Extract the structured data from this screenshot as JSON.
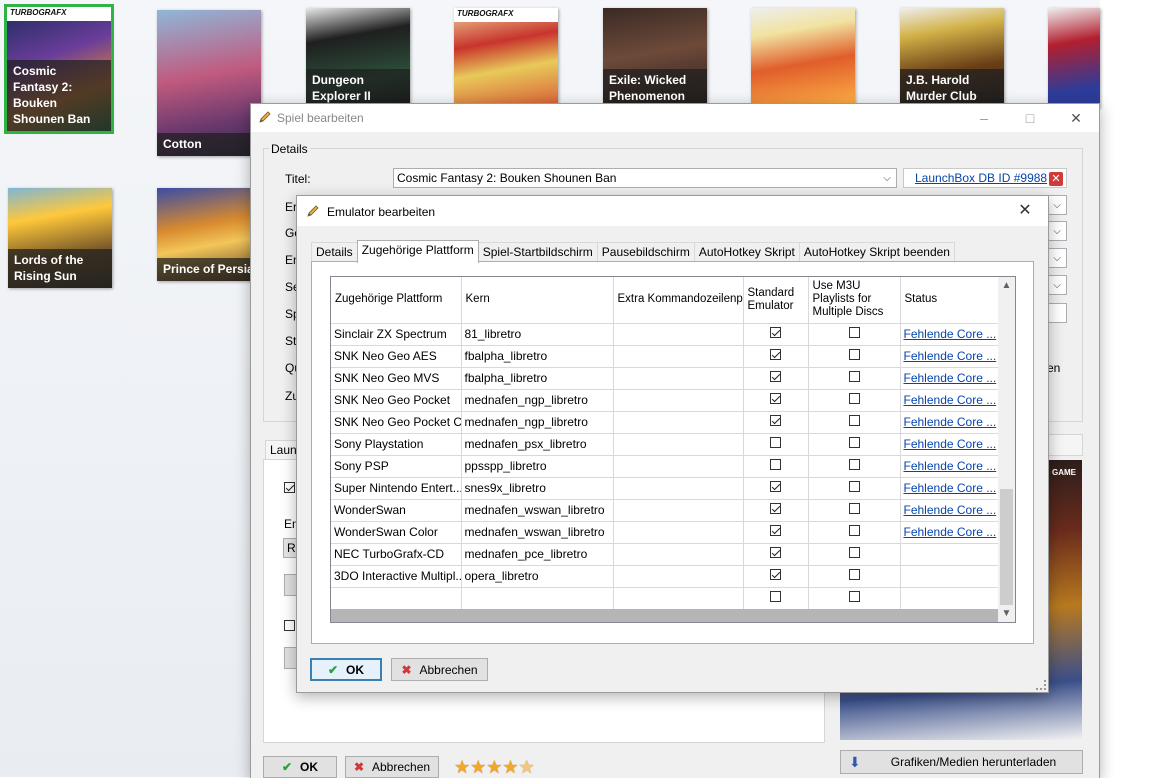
{
  "background": {
    "tiles": [
      {
        "label": "Cosmic Fantasy 2: Bouken Shounen Ban",
        "badge": "TURBOGRAFX"
      },
      {
        "label": "Cotton"
      },
      {
        "label": "Dungeon Explorer II"
      },
      {
        "label": "",
        "badge": "TURBOGRAFX"
      },
      {
        "label": "Exile: Wicked Phenomenon"
      },
      {
        "label": ""
      },
      {
        "label": "J.B. Harold Murder Club"
      },
      {
        "label": ""
      },
      {
        "label": "Lords of the Rising Sun"
      },
      {
        "label": "Prince of Persia"
      }
    ]
  },
  "edit_dialog": {
    "title": "Spiel bearbeiten",
    "details_group": "Details",
    "title_label": "Titel:",
    "title_value": "Cosmic Fantasy 2: Bouken Shounen Ban",
    "db_link": "LaunchBox DB ID #9988",
    "side_labels": [
      "Ers",
      "Ge",
      "En",
      "Se",
      "Sp",
      "Sta",
      "Qu",
      "Zu"
    ],
    "launch_tab_fragment": "Launc",
    "em_fragment": "Em",
    "re_fragment": "Re",
    "right_fragment": "en",
    "cover_badge": "GAME",
    "ok": "OK",
    "cancel": "Abbrechen",
    "rating": 4.5,
    "download_button": "Grafiken/Medien herunterladen"
  },
  "emulator_dialog": {
    "title": "Emulator bearbeiten",
    "tabs": [
      "Details",
      "Zugehörige Plattform",
      "Spiel-Startbildschirm",
      "Pausebildschirm",
      "AutoHotkey Skript",
      "AutoHotkey Skript beenden"
    ],
    "columns": [
      "Zugehörige Plattform",
      "Kern",
      "Extra Kommandozeilenparameter",
      "Standard Emulator",
      "Use M3U Playlists for Multiple Discs",
      "Status"
    ],
    "rows": [
      {
        "platform": "Sinclair ZX Spectrum",
        "core": "81_libretro",
        "extra": "",
        "standard": true,
        "m3u": false,
        "status": "Fehlende Core ..."
      },
      {
        "platform": "SNK Neo Geo AES",
        "core": "fbalpha_libretro",
        "extra": "",
        "standard": true,
        "m3u": false,
        "status": "Fehlende Core ..."
      },
      {
        "platform": "SNK Neo Geo MVS",
        "core": "fbalpha_libretro",
        "extra": "",
        "standard": true,
        "m3u": false,
        "status": "Fehlende Core ..."
      },
      {
        "platform": "SNK Neo Geo Pocket",
        "core": "mednafen_ngp_libretro",
        "extra": "",
        "standard": true,
        "m3u": false,
        "status": "Fehlende Core ..."
      },
      {
        "platform": "SNK Neo Geo Pocket C...",
        "core": "mednafen_ngp_libretro",
        "extra": "",
        "standard": true,
        "m3u": false,
        "status": "Fehlende Core ..."
      },
      {
        "platform": "Sony Playstation",
        "core": "mednafen_psx_libretro",
        "extra": "",
        "standard": false,
        "m3u": false,
        "status": "Fehlende Core ..."
      },
      {
        "platform": "Sony PSP",
        "core": "ppsspp_libretro",
        "extra": "",
        "standard": false,
        "m3u": false,
        "status": "Fehlende Core ..."
      },
      {
        "platform": "Super Nintendo Entert...",
        "core": "snes9x_libretro",
        "extra": "",
        "standard": true,
        "m3u": false,
        "status": "Fehlende Core ..."
      },
      {
        "platform": "WonderSwan",
        "core": "mednafen_wswan_libretro",
        "extra": "",
        "standard": true,
        "m3u": false,
        "status": "Fehlende Core ..."
      },
      {
        "platform": "WonderSwan Color",
        "core": "mednafen_wswan_libretro",
        "extra": "",
        "standard": true,
        "m3u": false,
        "status": "Fehlende Core ..."
      },
      {
        "platform": "NEC TurboGrafx-CD",
        "core": "mednafen_pce_libretro",
        "extra": "",
        "standard": true,
        "m3u": false,
        "status": ""
      },
      {
        "platform": "3DO Interactive Multipl...",
        "core": "opera_libretro",
        "extra": "",
        "standard": true,
        "m3u": false,
        "status": ""
      },
      {
        "platform": "",
        "core": "",
        "extra": "",
        "standard": false,
        "m3u": false,
        "status": ""
      }
    ],
    "ok": "OK",
    "cancel": "Abbrechen"
  },
  "colors": {
    "accent_green": "#2fb344",
    "link": "#0645ad",
    "ok_check": "#2e9e3e",
    "cancel_x": "#d23a3a",
    "star": "#f5a623"
  }
}
